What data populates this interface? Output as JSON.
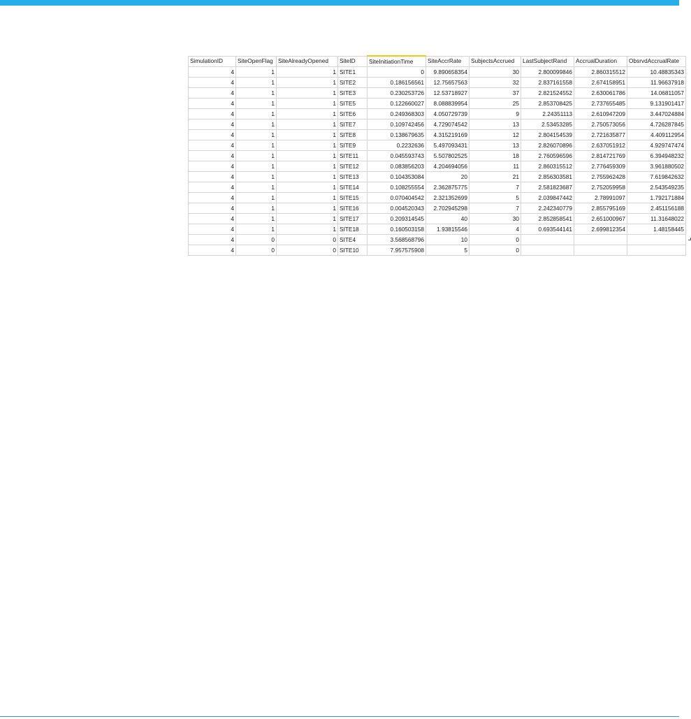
{
  "sheet": {
    "columns": [
      "SimulationID",
      "SiteOpenFlag",
      "SiteAlreadyOpened",
      "SiteID",
      "SiteInitiationTime",
      "SiteAccrRate",
      "SubjectsAccrued",
      "LastSubjectRand",
      "AccrualDuration",
      "ObsrvdAccrualRate"
    ],
    "selected_column": "SiteInitiationTime",
    "rows": [
      [
        "4",
        "1",
        "1",
        "SITE1",
        "0",
        "9.890658354",
        "30",
        "2.800099846",
        "2.860315512",
        "10.48835343"
      ],
      [
        "4",
        "1",
        "1",
        "SITE2",
        "0.186156561",
        "12.75657563",
        "32",
        "2.837161558",
        "2.674158951",
        "11.96637918"
      ],
      [
        "4",
        "1",
        "1",
        "SITE3",
        "0.230253726",
        "12.53718927",
        "37",
        "2.821524552",
        "2.630061786",
        "14.06811057"
      ],
      [
        "4",
        "1",
        "1",
        "SITE5",
        "0.122660027",
        "8.088839954",
        "25",
        "2.853708425",
        "2.737655485",
        "9.131901417"
      ],
      [
        "4",
        "1",
        "1",
        "SITE6",
        "0.249368303",
        "4.050729739",
        "9",
        "2.24351113",
        "2.610947209",
        "3.447024884"
      ],
      [
        "4",
        "1",
        "1",
        "SITE7",
        "0.109742456",
        "4.729074542",
        "13",
        "2.53453285",
        "2.750573056",
        "4.726287845"
      ],
      [
        "4",
        "1",
        "1",
        "SITE8",
        "0.138679635",
        "4.315219169",
        "12",
        "2.804154539",
        "2.721635877",
        "4.409112954"
      ],
      [
        "4",
        "1",
        "1",
        "SITE9",
        "0.2232636",
        "5.497093431",
        "13",
        "2.826070896",
        "2.637051912",
        "4.929747474"
      ],
      [
        "4",
        "1",
        "1",
        "SITE11",
        "0.045593743",
        "5.507802525",
        "18",
        "2.760596596",
        "2.814721769",
        "6.394948232"
      ],
      [
        "4",
        "1",
        "1",
        "SITE12",
        "0.083856203",
        "4.204694056",
        "11",
        "2.860315512",
        "2.776459309",
        "3.961880502"
      ],
      [
        "4",
        "1",
        "1",
        "SITE13",
        "0.104353084",
        "20",
        "21",
        "2.856303581",
        "2.755962428",
        "7.619842632"
      ],
      [
        "4",
        "1",
        "1",
        "SITE14",
        "0.108255554",
        "2.362875775",
        "7",
        "2.581823687",
        "2.752059958",
        "2.543549235"
      ],
      [
        "4",
        "1",
        "1",
        "SITE15",
        "0.070404542",
        "2.321352699",
        "5",
        "2.039847442",
        "2.78991097",
        "1.792171884"
      ],
      [
        "4",
        "1",
        "1",
        "SITE16",
        "0.004520343",
        "2.702945298",
        "7",
        "2.242340779",
        "2.855795169",
        "2.451156188"
      ],
      [
        "4",
        "1",
        "1",
        "SITE17",
        "0.209314545",
        "40",
        "30",
        "2.852858541",
        "2.651000967",
        "11.31648022"
      ],
      [
        "4",
        "1",
        "1",
        "SITE18",
        "0.160503158",
        "1.93815546",
        "4",
        "0.693544141",
        "2.699812354",
        "1.48158445"
      ],
      [
        "4",
        "0",
        "0",
        "SITE4",
        "3.568568796",
        "10",
        "0",
        "",
        "",
        ""
      ],
      [
        "4",
        "0",
        "0",
        "SITE10",
        "7.957575908",
        "5",
        "0",
        "",
        "",
        ""
      ]
    ]
  }
}
